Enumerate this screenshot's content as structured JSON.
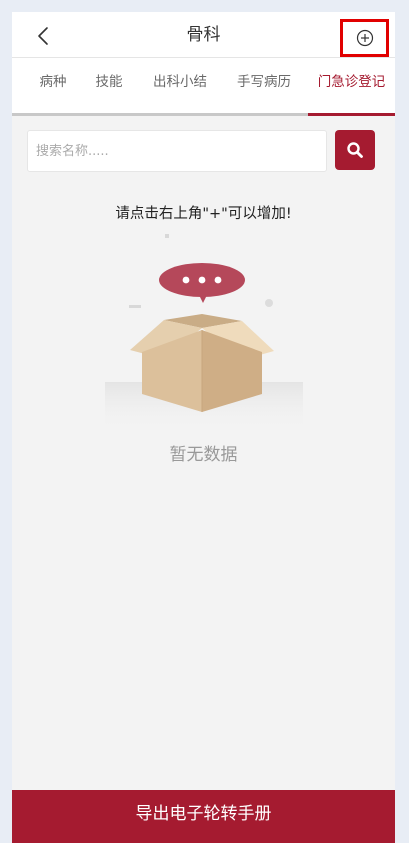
{
  "header": {
    "title": "骨科",
    "back_icon": "chevron-left-icon",
    "add_icon": "plus-circle-icon"
  },
  "tabs": [
    {
      "label": "病种"
    },
    {
      "label": "技能"
    },
    {
      "label": "出科小结"
    },
    {
      "label": "手写病历"
    },
    {
      "label": "门急诊登记",
      "active": true
    }
  ],
  "search": {
    "placeholder": "搜索名称.....",
    "value": "",
    "button_icon": "search-icon"
  },
  "hint_text": "请点击右上角\"+\"可以增加!",
  "empty": {
    "illustration": "empty-box-illustration",
    "text": "暂无数据"
  },
  "footer": {
    "button_label": "导出电子轮转手册"
  },
  "colors": {
    "accent": "#a51b30",
    "highlight_border": "#e10000",
    "background": "#f3f3f3"
  }
}
